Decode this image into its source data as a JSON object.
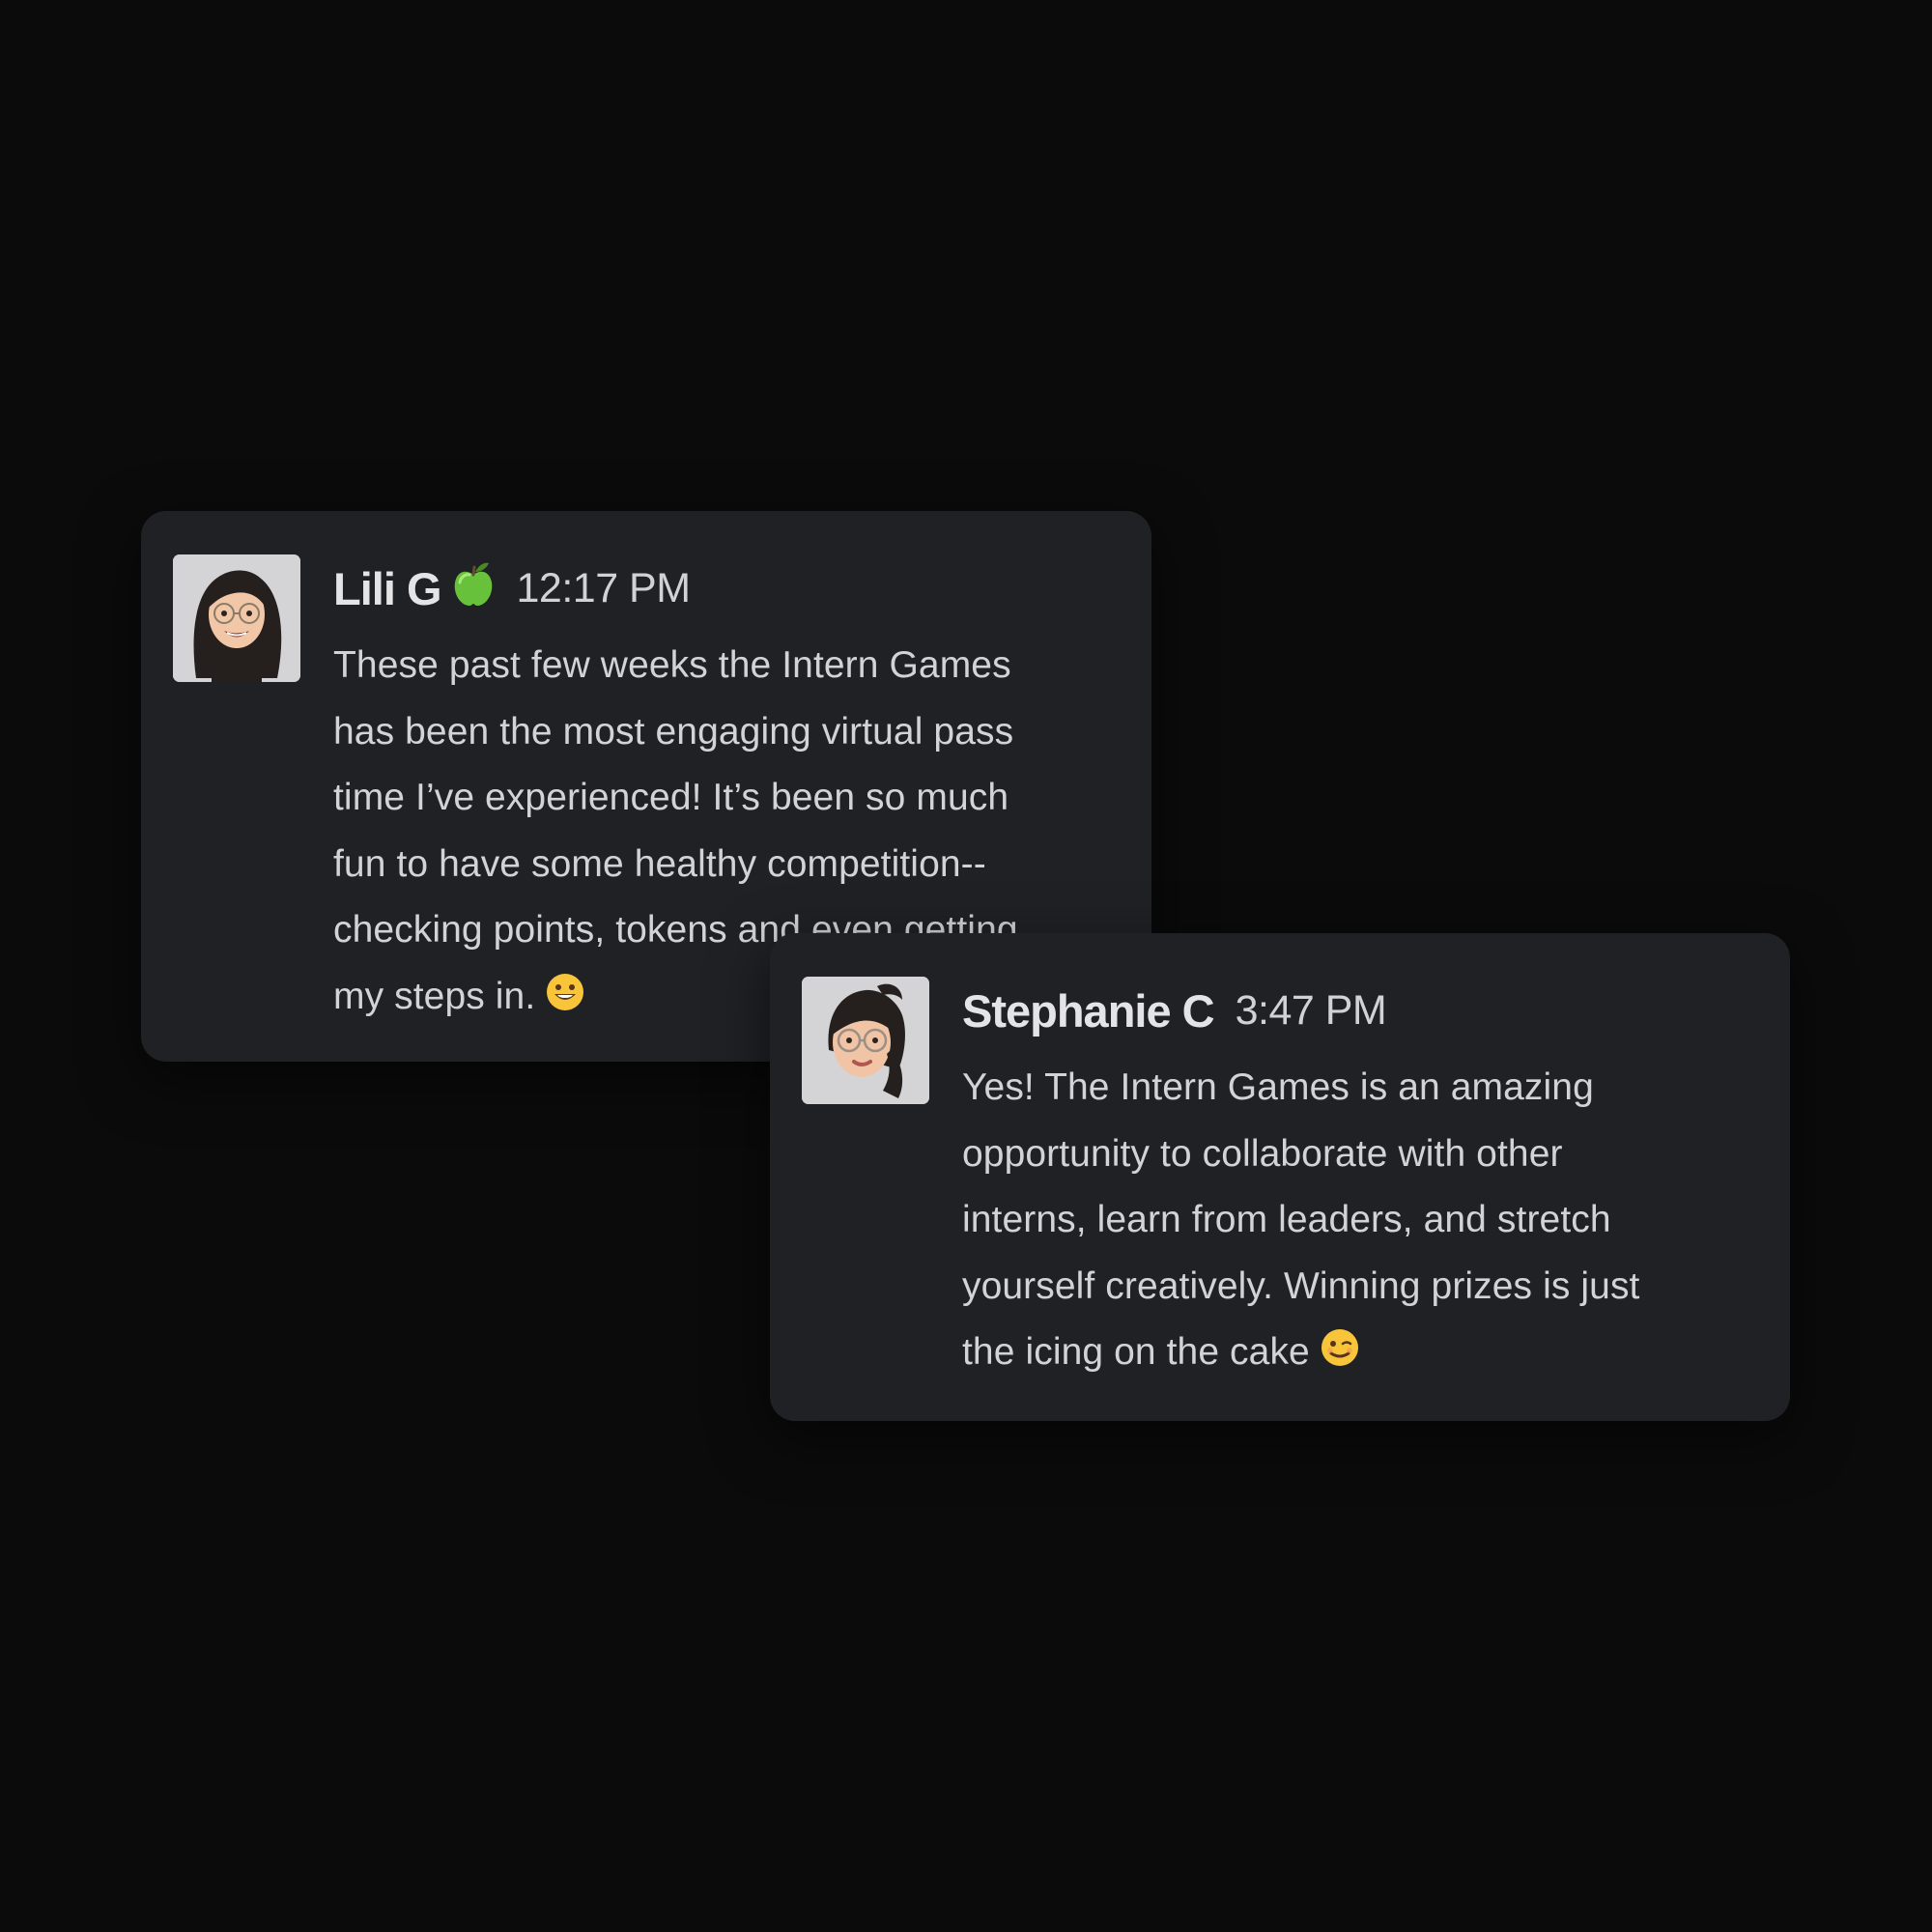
{
  "messages": [
    {
      "author": "Lili G",
      "author_badge_icon": "green-apple-icon",
      "time": "12:17 PM",
      "text": "These past few weeks the Intern Games\nhas been the most engaging virtual pass\ntime I’ve experienced! It’s been so much\nfun to have some healthy competition--\nchecking points, tokens and even getting\nmy steps in.",
      "emoji_icon": "grinning-face-icon",
      "avatar_icon": "memoji-avatar-icon"
    },
    {
      "author": "Stephanie C",
      "time": "3:47 PM",
      "text": "Yes! The Intern Games is an amazing\nopportunity to collaborate with other\ninterns, learn from leaders, and stretch\nyourself creatively. Winning prizes is just\nthe icing on the cake",
      "emoji_icon": "winking-face-icon",
      "avatar_icon": "memoji-avatar-icon"
    }
  ],
  "colors": {
    "background": "#0b0b0c",
    "card": "#202125",
    "text": "#d3d3d6",
    "name": "#e4e4e6"
  }
}
